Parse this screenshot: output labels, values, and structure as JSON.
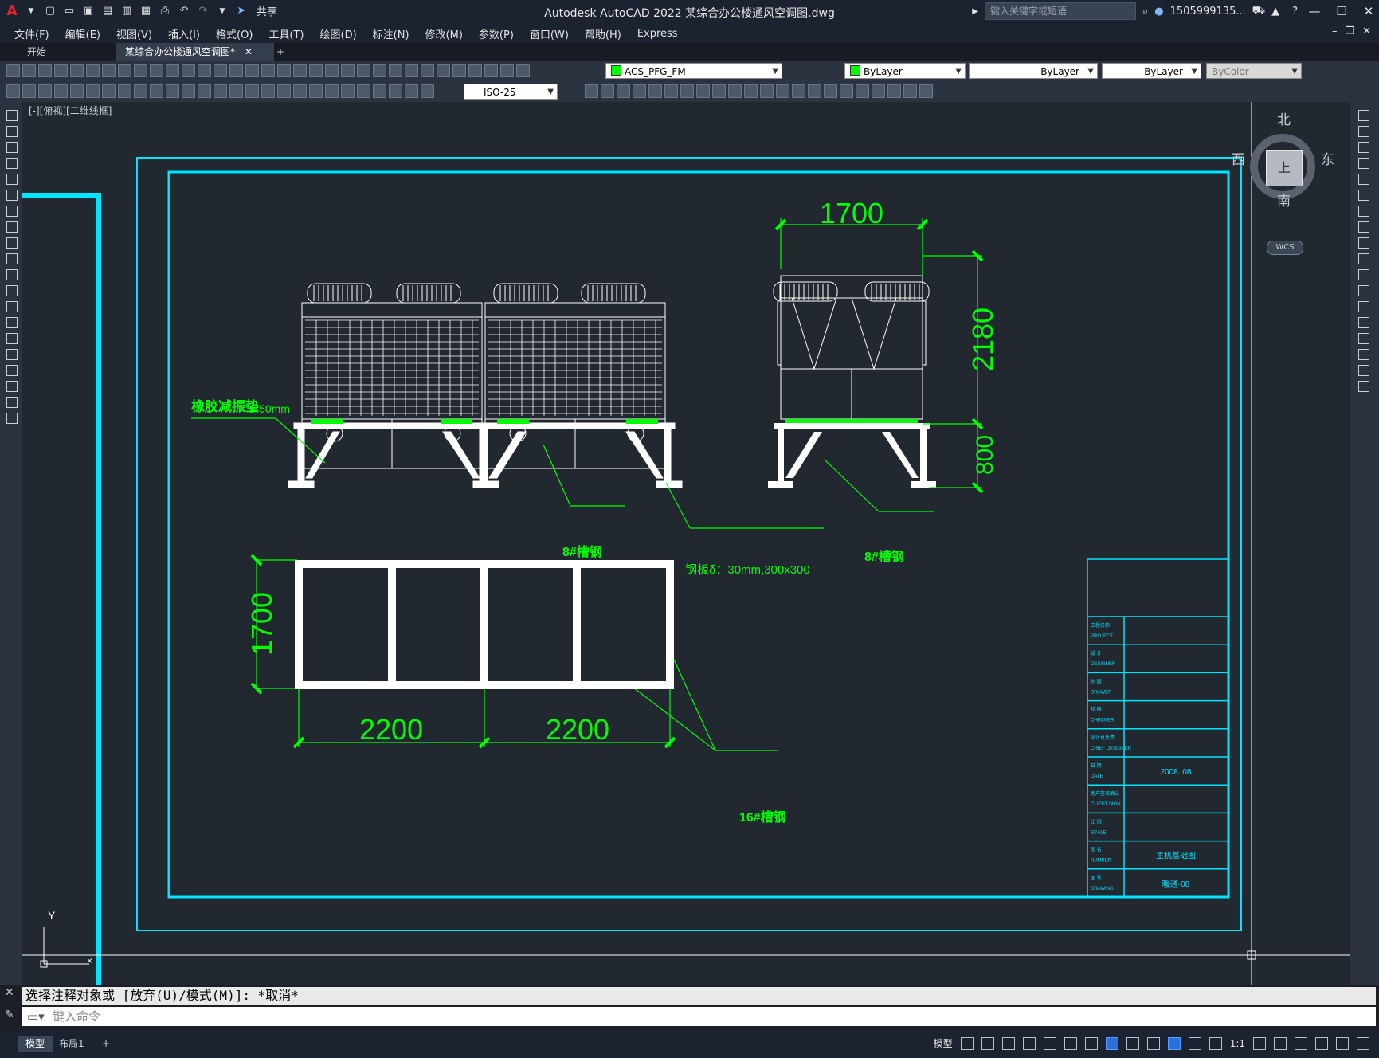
{
  "app": {
    "title": "Autodesk AutoCAD 2022    某综合办公楼通风空调图.dwg",
    "share_label": "共享",
    "search_placeholder": "键入关键字或短语",
    "user": "1505999135..."
  },
  "menu": [
    "文件(F)",
    "编辑(E)",
    "视图(V)",
    "插入(I)",
    "格式(O)",
    "工具(T)",
    "绘图(D)",
    "标注(N)",
    "修改(M)",
    "参数(P)",
    "窗口(W)",
    "帮助(H)",
    "Express"
  ],
  "tabs": {
    "start": "开始",
    "active": "某综合办公楼通风空调图*",
    "add": "+"
  },
  "toolbar": {
    "layer": "ACS_PFG_FM",
    "color": "ByLayer",
    "linetype": "ByLayer",
    "lineweight": "ByLayer",
    "plotstyle": "ByColor",
    "dimstyle": "ISO-25"
  },
  "viewport": {
    "label": "[-][俯视][二维线框]"
  },
  "viewcube": {
    "north": "北",
    "south": "南",
    "east": "东",
    "west": "西",
    "face": "上",
    "wcs": "WCS"
  },
  "drawing": {
    "dim_top": "1700",
    "dim_height": "2180",
    "dim_base": "800",
    "dim_plan_side": "1700",
    "dim_plan_a": "2200",
    "dim_plan_b": "2200",
    "label_rubber": "橡胶减振垫",
    "label_rubber_t": "t=50mm",
    "label_channel_a": "8#槽钢",
    "label_channel_b": "8#槽钢",
    "label_plate": "钢板δ：30mm,300x300",
    "label_channel_c": "16#槽钢",
    "axis_y": "Y"
  },
  "title_block": {
    "rows": [
      {
        "cn": "工程名称",
        "en": "PROJECT",
        "value": ""
      },
      {
        "cn": "设  计",
        "en": "DESIGNER",
        "value": ""
      },
      {
        "cn": "制  图",
        "en": "DRAWER",
        "value": ""
      },
      {
        "cn": "校  核",
        "en": "CHECKER",
        "value": ""
      },
      {
        "cn": "设计总负责",
        "en": "CHIEF DESIGNER",
        "value": ""
      },
      {
        "cn": "日  期",
        "en": "DATE",
        "value": "2008. 08"
      },
      {
        "cn": "客户签名确认",
        "en": "CLIENT SIGN",
        "value": ""
      },
      {
        "cn": "比  例",
        "en": "SCALE",
        "value": ""
      },
      {
        "cn": "图  名",
        "en": "NUMBER",
        "value": "主机基础图"
      },
      {
        "cn": "图  号",
        "en": "DRAWING",
        "value": "暖通-08"
      }
    ]
  },
  "command": {
    "history": "选择注释对象或 [放弃(U)/模式(M)]: *取消*",
    "placeholder": "键入命令"
  },
  "status": {
    "model": "模型",
    "layout": "布局1",
    "add": "+",
    "model_toggle": "模型",
    "scale": "1:1"
  },
  "colors": {
    "cyan": "#00e5ff",
    "green": "#00ff00",
    "white": "#ffffff",
    "bg": "#212830"
  }
}
